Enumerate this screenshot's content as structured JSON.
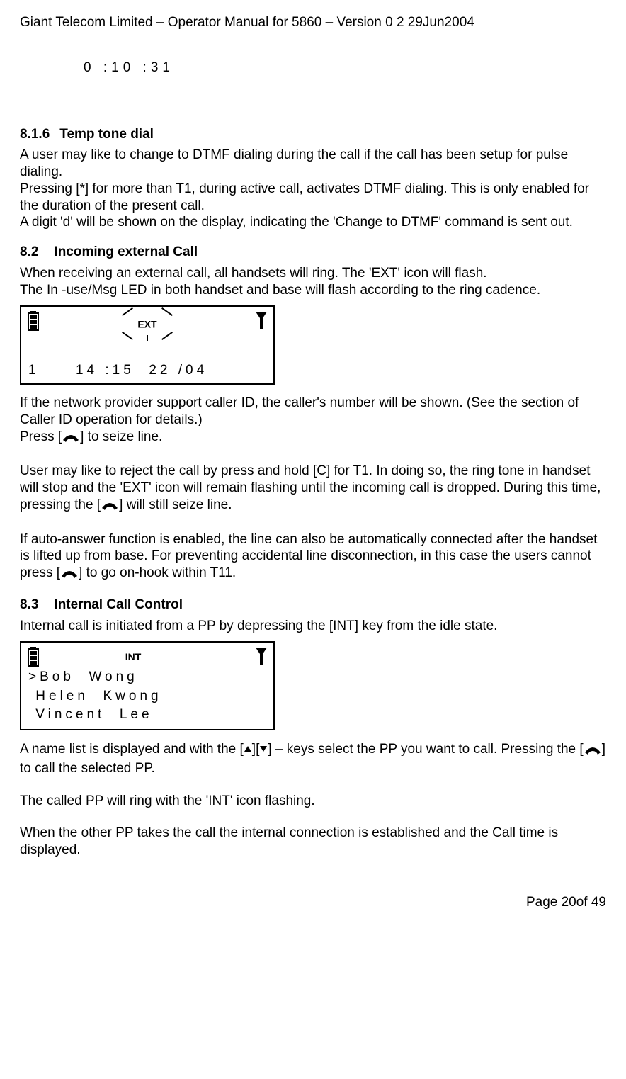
{
  "header": "Giant Telecom Limited – Operator Manual for 5860 – Version 0 2 29Jun2004",
  "timer": "0 :10 :31",
  "s816": {
    "num": "8.1.6",
    "title": "Temp tone dial",
    "p1": "A user may like to change to DTMF dialing during the call if the call has been setup for pulse dialing.",
    "p2": "Pressing [*] for more than T1, during active call, activates DTMF dialing. This is only enabled for the duration of the present call.",
    "p3": "A digit 'd' will be shown on the display, indicating the 'Change to DTMF' command is sent out."
  },
  "s82": {
    "num": "8.2",
    "title": "Incoming external Call",
    "p1": "When receiving an external call, all handsets will ring. The 'EXT' icon will flash.",
    "p2": "The In -use/Msg LED in both handset and base will flash according to the ring cadence.",
    "lcd_ext": "EXT",
    "lcd_line": "1     14 :15  22 /04",
    "p3": "If the network provider support caller ID, the caller's number will be shown. (See the section of Caller ID operation for details.)",
    "p4a": "Press [",
    "p4b": "] to seize line.",
    "p5a": "User may like to reject the call by press and hold [C] for T1. In doing so, the ring tone in handset will stop and the 'EXT' icon will remain flashing until the incoming call is dropped. During this time, pressing the [",
    "p5b": "] will still seize line.",
    "p6a": "If auto-answer function is enabled, the line can also be automatically connected after the handset is lifted up from base. For preventing accidental line disconnection, in this case the users cannot press [",
    "p6b": "] to go on-hook within T11."
  },
  "s83": {
    "num": "8.3",
    "title": "Internal Call Control",
    "p1": "Internal call is initiated from a PP by depressing the [INT] key from the idle state.",
    "lcd_int": "INT",
    "name1": ">Bob  Wong",
    "name2": " Helen  Kwong",
    "name3": " Vincent  Lee",
    "p2a": "A name list is displayed and with the [",
    "p2b": "][",
    "p2c": "] – keys select the PP you want to call. Pressing the [",
    "p2d": "] to call the selected PP.",
    "p3": "The called PP will ring with the 'INT' icon flashing.",
    "p4": "When the other PP takes the call the internal connection is established and the Call time is displayed."
  },
  "footer": "Page 20of 49"
}
